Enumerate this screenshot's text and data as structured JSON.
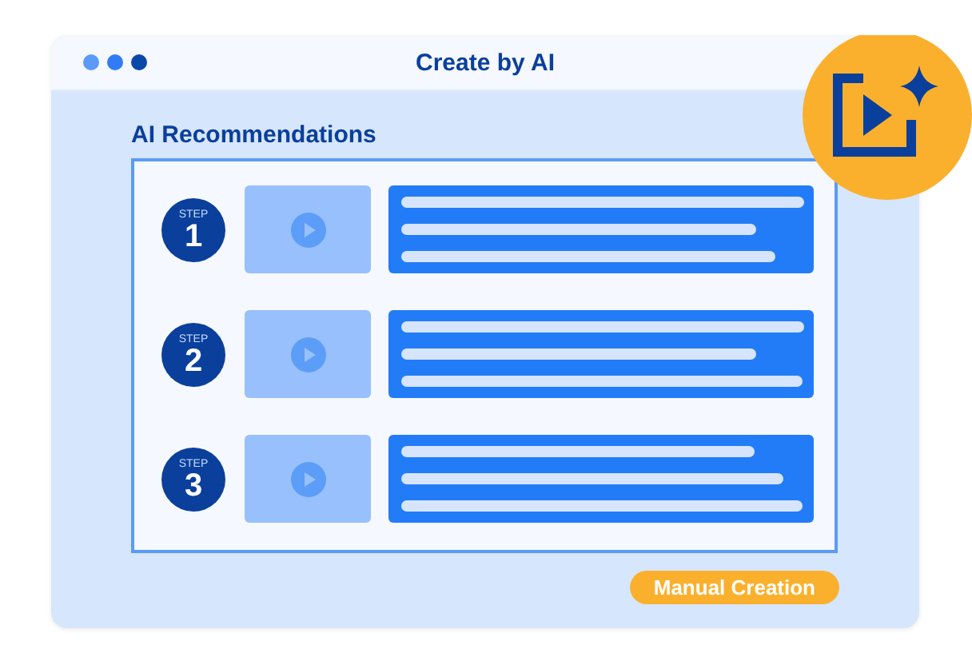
{
  "window": {
    "title": "Create by AI"
  },
  "section": {
    "heading": "AI Recommendations"
  },
  "steps": [
    {
      "label": "STEP",
      "number": "1"
    },
    {
      "label": "STEP",
      "number": "2"
    },
    {
      "label": "STEP",
      "number": "3"
    }
  ],
  "manual_button": {
    "label": "Manual Creation"
  }
}
